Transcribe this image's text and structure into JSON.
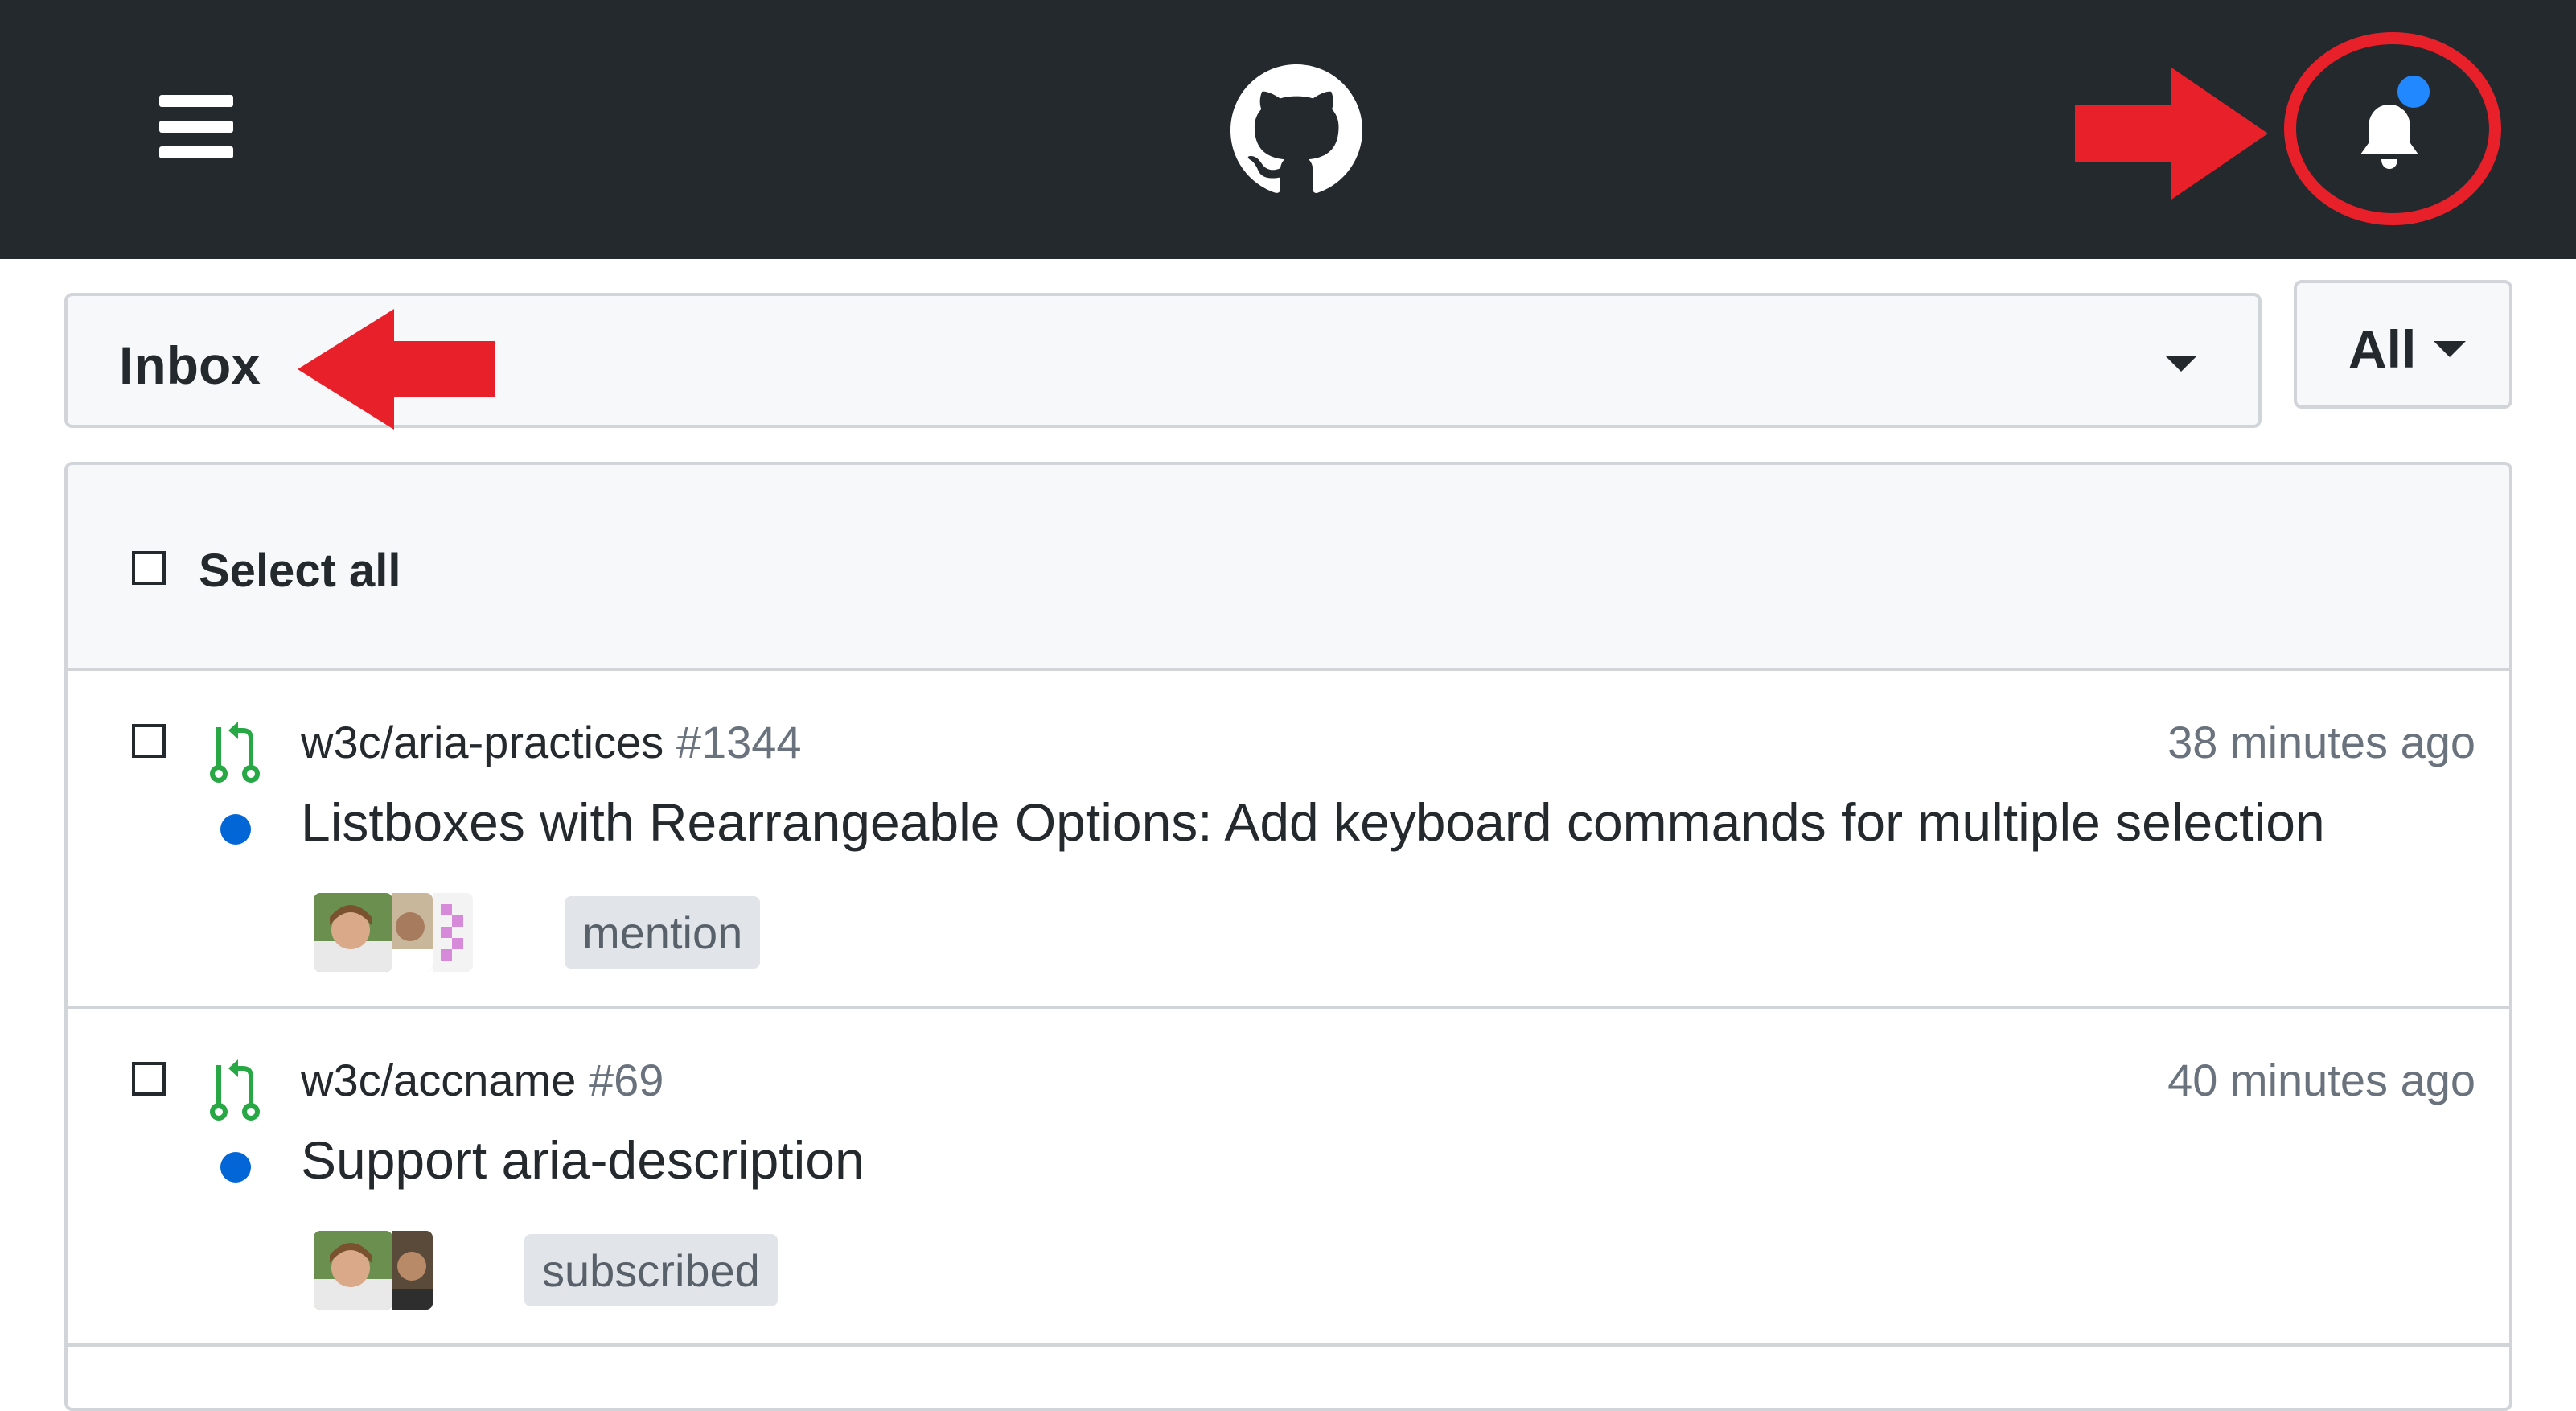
{
  "header": {
    "menu_icon": "hamburger-menu-icon",
    "logo_icon": "github-octocat-icon",
    "notifications_icon": "bell-icon",
    "unread_indicator_color": "#2188ff",
    "annotation_color": "#e8202a"
  },
  "filters": {
    "inbox_label": "Inbox",
    "all_label": "All"
  },
  "list": {
    "select_all_label": "Select all",
    "items": [
      {
        "repo": "w3c/aria-practices",
        "number": "#1344",
        "time": "38 minutes ago",
        "title": "Listboxes with Rearrangeable Options: Add keyboard commands for multiple selection",
        "reason": "mention",
        "type_icon": "pull-request-icon",
        "unread": true
      },
      {
        "repo": "w3c/accname",
        "number": "#69",
        "time": "40 minutes ago",
        "title": "Support aria-description",
        "reason": "subscribed",
        "type_icon": "pull-request-icon",
        "unread": true
      }
    ]
  }
}
